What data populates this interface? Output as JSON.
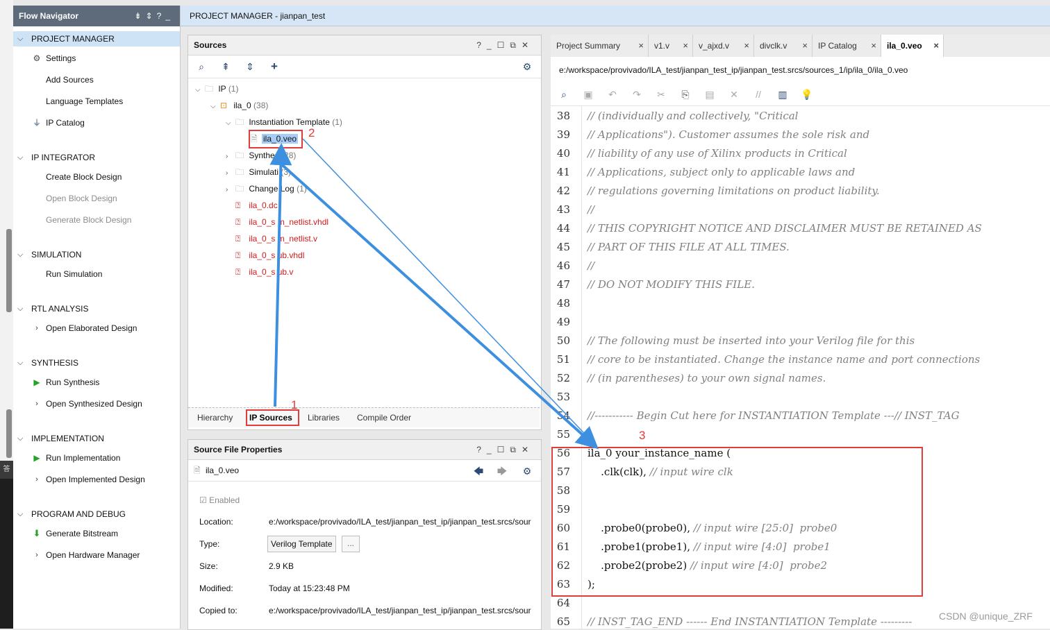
{
  "flow_navigator": {
    "title": "Flow Navigator",
    "sections": [
      {
        "label": "PROJECT MANAGER",
        "items": [
          {
            "label": "Settings",
            "icon": "gear-icon"
          },
          {
            "label": "Add Sources"
          },
          {
            "label": "Language Templates"
          },
          {
            "label": "IP Catalog",
            "icon": "plug-icon"
          }
        ]
      },
      {
        "label": "IP INTEGRATOR",
        "items": [
          {
            "label": "Create Block Design"
          },
          {
            "label": "Open Block Design",
            "disabled": true
          },
          {
            "label": "Generate Block Design",
            "disabled": true
          }
        ]
      },
      {
        "label": "SIMULATION",
        "items": [
          {
            "label": "Run Simulation"
          }
        ]
      },
      {
        "label": "RTL ANALYSIS",
        "items": [
          {
            "label": "Open Elaborated Design"
          }
        ]
      },
      {
        "label": "SYNTHESIS",
        "items": [
          {
            "label": "Run Synthesis",
            "icon": "play-icon"
          },
          {
            "label": "Open Synthesized Design"
          }
        ]
      },
      {
        "label": "IMPLEMENTATION",
        "items": [
          {
            "label": "Run Implementation",
            "icon": "play-icon"
          },
          {
            "label": "Open Implemented Design"
          }
        ]
      },
      {
        "label": "PROGRAM AND DEBUG",
        "items": [
          {
            "label": "Generate Bitstream",
            "icon": "bitstream-icon"
          },
          {
            "label": "Open Hardware Manager"
          }
        ]
      }
    ]
  },
  "title_bar": "PROJECT MANAGER - jianpan_test",
  "sources": {
    "title": "Sources",
    "tree": {
      "ip": {
        "label": "IP",
        "count": "(1)"
      },
      "ila": {
        "label": "ila_0",
        "count": "(38)"
      },
      "inst": {
        "label": "Instantiation Template",
        "count": "(1)"
      },
      "veo": {
        "label": "ila_0.veo"
      },
      "synth": {
        "label": "Synthes",
        "count": "(28)"
      },
      "sim": {
        "label": "Simulati",
        "count": "(3)"
      },
      "change": {
        "label": "Change Log",
        "count": "(1)"
      },
      "dcp": {
        "label": "ila_0.dc"
      },
      "simvhdl": {
        "label": "ila_0_s  m_netlist.vhdl"
      },
      "simv": {
        "label": "ila_0_s  m_netlist.v"
      },
      "stubvhdl": {
        "label": "ila_0_s  ub.vhdl"
      },
      "stubv": {
        "label": "ila_0_s  ub.v"
      }
    },
    "tabs": [
      "Hierarchy",
      "IP Sources",
      "Libraries",
      "Compile Order"
    ]
  },
  "props": {
    "title": "Source File Properties",
    "file": "ila_0.veo",
    "enabled": "Enabled",
    "location_label": "Location:",
    "location": "e:/workspace/provivado/ILA_test/jianpan_test_ip/jianpan_test.srcs/sour",
    "type_label": "Type:",
    "type": "Verilog Template",
    "more": "...",
    "size_label": "Size:",
    "size": "2.9 KB",
    "modified_label": "Modified:",
    "modified": "Today at 15:23:48 PM",
    "copied_label": "Copied to:",
    "copied": "e:/workspace/provivado/ILA_test/jianpan_test_ip/jianpan_test.srcs/sour"
  },
  "editor": {
    "tabs": [
      "Project Summary",
      "v1.v",
      "v_ajxd.v",
      "divclk.v",
      "IP Catalog",
      "ila_0.veo"
    ],
    "path": "e:/workspace/provivado/ILA_test/jianpan_test_ip/jianpan_test.srcs/sources_1/ip/ila_0/ila_0.veo",
    "lines": [
      {
        "n": "38",
        "code": "",
        "comment": "// (individually and collectively, \"Critical"
      },
      {
        "n": "39",
        "code": "",
        "comment": "// Applications\"). Customer assumes the sole risk and"
      },
      {
        "n": "40",
        "code": "",
        "comment": "// liability of any use of Xilinx products in Critical"
      },
      {
        "n": "41",
        "code": "",
        "comment": "// Applications, subject only to applicable laws and"
      },
      {
        "n": "42",
        "code": "",
        "comment": "// regulations governing limitations on product liability."
      },
      {
        "n": "43",
        "code": "",
        "comment": "//"
      },
      {
        "n": "44",
        "code": "",
        "comment": "// THIS COPYRIGHT NOTICE AND DISCLAIMER MUST BE RETAINED AS"
      },
      {
        "n": "45",
        "code": "",
        "comment": "// PART OF THIS FILE AT ALL TIMES."
      },
      {
        "n": "46",
        "code": "",
        "comment": "//"
      },
      {
        "n": "47",
        "code": "",
        "comment": "// DO NOT MODIFY THIS FILE."
      },
      {
        "n": "48",
        "code": "",
        "comment": ""
      },
      {
        "n": "49",
        "code": "",
        "comment": ""
      },
      {
        "n": "50",
        "code": "",
        "comment": "// The following must be inserted into your Verilog file for this"
      },
      {
        "n": "51",
        "code": "",
        "comment": "// core to be instantiated. Change the instance name and port connections"
      },
      {
        "n": "52",
        "code": "",
        "comment": "// (in parentheses) to your own signal names."
      },
      {
        "n": "53",
        "code": "",
        "comment": ""
      },
      {
        "n": "54",
        "code": "",
        "comment": "//----------- Begin Cut here for INSTANTIATION Template ---// INST_TAG"
      },
      {
        "n": "55",
        "code": "",
        "comment": ""
      },
      {
        "n": "56",
        "code": "ila_0 your_instance_name (",
        "comment": ""
      },
      {
        "n": "57",
        "code": "    .clk(clk), ",
        "comment": "// input wire clk"
      },
      {
        "n": "58",
        "code": "",
        "comment": ""
      },
      {
        "n": "59",
        "code": "",
        "comment": ""
      },
      {
        "n": "60",
        "code": "    .probe0(probe0), ",
        "comment": "// input wire [25:0]  probe0"
      },
      {
        "n": "61",
        "code": "    .probe1(probe1), ",
        "comment": "// input wire [4:0]  probe1"
      },
      {
        "n": "62",
        "code": "    .probe2(probe2) ",
        "comment": "// input wire [4:0]  probe2"
      },
      {
        "n": "63",
        "code": ");",
        "comment": ""
      },
      {
        "n": "64",
        "code": "",
        "comment": ""
      },
      {
        "n": "65",
        "code": "",
        "comment": "// INST_TAG_END ------ End INSTANTIATION Template ---------"
      }
    ]
  },
  "annotations": {
    "n1": "1",
    "n2": "2",
    "n3": "3",
    "color": "#e23b3b",
    "arrow_color": "#3d8fe0"
  },
  "watermark": "CSDN @unique_ZRF",
  "strip_char": "答"
}
